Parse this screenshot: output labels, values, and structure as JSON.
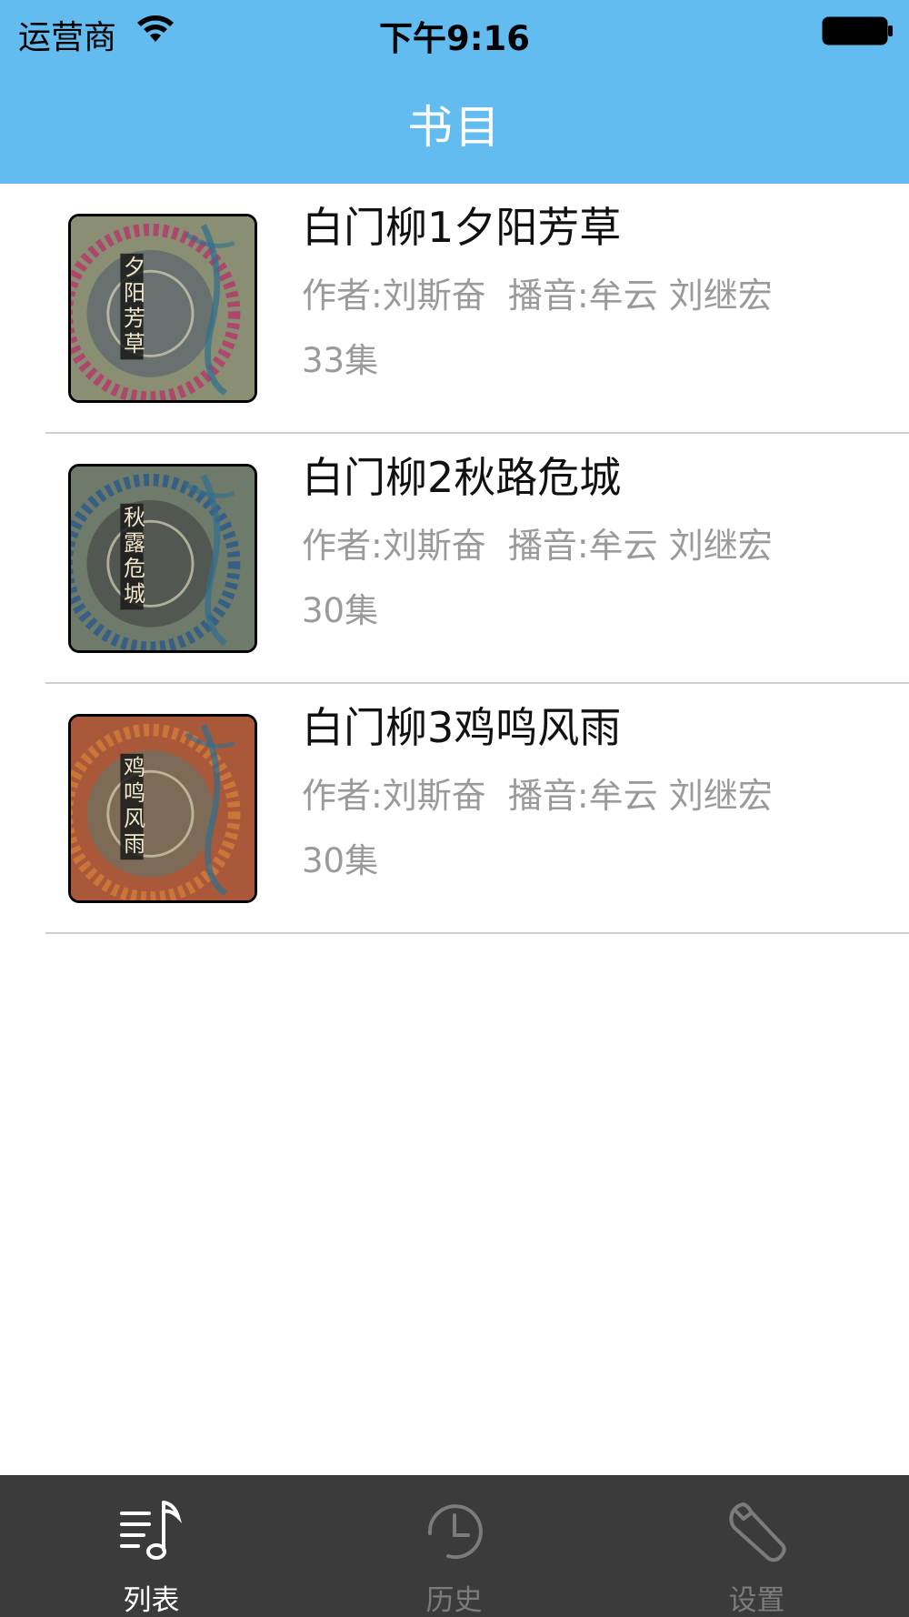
{
  "status_bar": {
    "carrier": "运营商",
    "time": "下午9:16"
  },
  "nav": {
    "title": "书目"
  },
  "books": [
    {
      "title": "白门柳1夕阳芳草",
      "author": "作者:刘斯奋",
      "narrator": "播音:牟云 刘继宏",
      "episodes": "33集",
      "cover_text": "夕阳芳草",
      "cover_colors": {
        "base": "#8a8f74",
        "accent": "#b33b6a",
        "ring": "#4d5a6b"
      }
    },
    {
      "title": "白门柳2秋路危城",
      "author": "作者:刘斯奋",
      "narrator": "播音:牟云 刘继宏",
      "episodes": "30集",
      "cover_text": "秋露危城",
      "cover_colors": {
        "base": "#6e7a6a",
        "accent": "#2e5a8a",
        "ring": "#3d3d3d"
      }
    },
    {
      "title": "白门柳3鸡鸣风雨",
      "author": "作者:刘斯奋",
      "narrator": "播音:牟云 刘继宏",
      "episodes": "30集",
      "cover_text": "鸡鸣风雨",
      "cover_colors": {
        "base": "#a9593a",
        "accent": "#d27a3a",
        "ring": "#5a7a70"
      }
    }
  ],
  "tabbar": {
    "tabs": [
      {
        "label": "列表",
        "icon": "music-list-icon",
        "active": true
      },
      {
        "label": "历史",
        "icon": "clock-icon",
        "active": false
      },
      {
        "label": "设置",
        "icon": "wrench-icon",
        "active": false
      }
    ],
    "active_color": "#ffffff",
    "inactive_color": "#7c7c7c"
  },
  "colors": {
    "header": "#63bcef",
    "tabbar": "#3b3b3b"
  }
}
